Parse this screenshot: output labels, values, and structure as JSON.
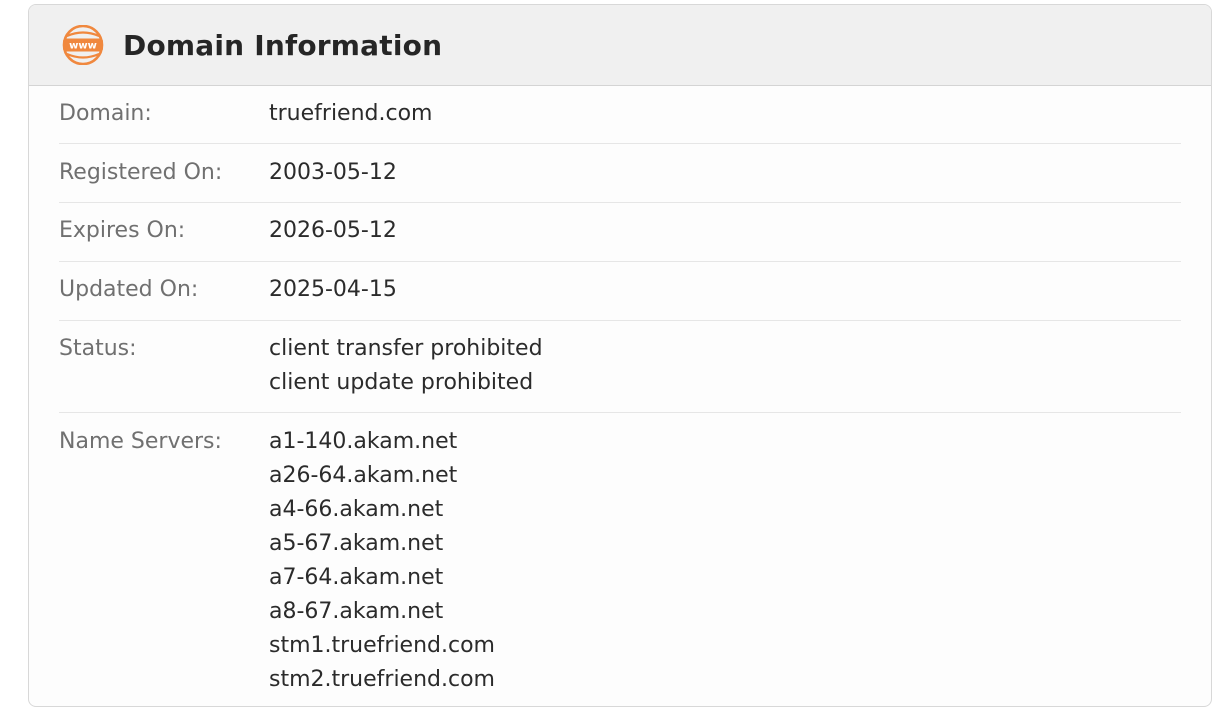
{
  "header": {
    "title": "Domain Information",
    "icon": "www-globe-icon",
    "icon_text": "www",
    "icon_color": "#f0883e"
  },
  "rows": [
    {
      "label": "Domain:",
      "values": [
        "truefriend.com"
      ]
    },
    {
      "label": "Registered On:",
      "values": [
        "2003-05-12"
      ]
    },
    {
      "label": "Expires On:",
      "values": [
        "2026-05-12"
      ]
    },
    {
      "label": "Updated On:",
      "values": [
        "2025-04-15"
      ]
    },
    {
      "label": "Status:",
      "values": [
        "client transfer prohibited",
        "client update prohibited"
      ]
    },
    {
      "label": "Name Servers:",
      "values": [
        "a1-140.akam.net",
        "a26-64.akam.net",
        "a4-66.akam.net",
        "a5-67.akam.net",
        "a7-64.akam.net",
        "a8-67.akam.net",
        "stm1.truefriend.com",
        "stm2.truefriend.com"
      ]
    }
  ]
}
